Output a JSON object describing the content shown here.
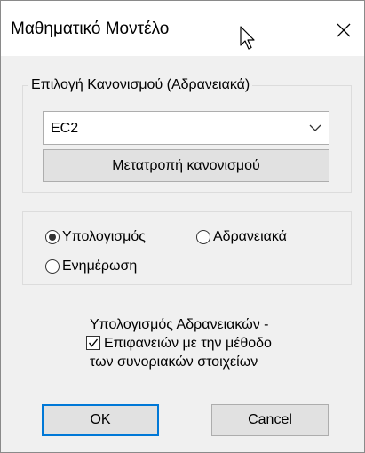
{
  "window": {
    "title": "Μαθηματικό Μοντέλο",
    "close_icon": "close-icon",
    "cursor_icon": "mouse-pointer-icon"
  },
  "code_group": {
    "legend": "Επιλογή Κανονισμού (Αδρανειακά)",
    "combo_value": "EC2",
    "combo_icon": "chevron-down-icon",
    "convert_button_label": "Μετατροπή κανονισμού"
  },
  "mode_group": {
    "options": [
      {
        "label": "Υπολογισμός",
        "selected": true
      },
      {
        "label": "Αδρανειακά",
        "selected": false
      },
      {
        "label": "Ενημέρωση",
        "selected": false
      }
    ]
  },
  "bem_option": {
    "checked": true,
    "lines": [
      "Υπολογισμός Αδρανειακών -",
      "Επιφανειών με την μέθοδο",
      "των συνοριακών στοιχείων"
    ]
  },
  "buttons": {
    "ok_label": "OK",
    "cancel_label": "Cancel"
  },
  "colors": {
    "dialog_bg": "#f0f0f0",
    "title_bg": "#ffffff",
    "default_button_border": "#0078d7",
    "button_bg": "#e1e1e1"
  }
}
